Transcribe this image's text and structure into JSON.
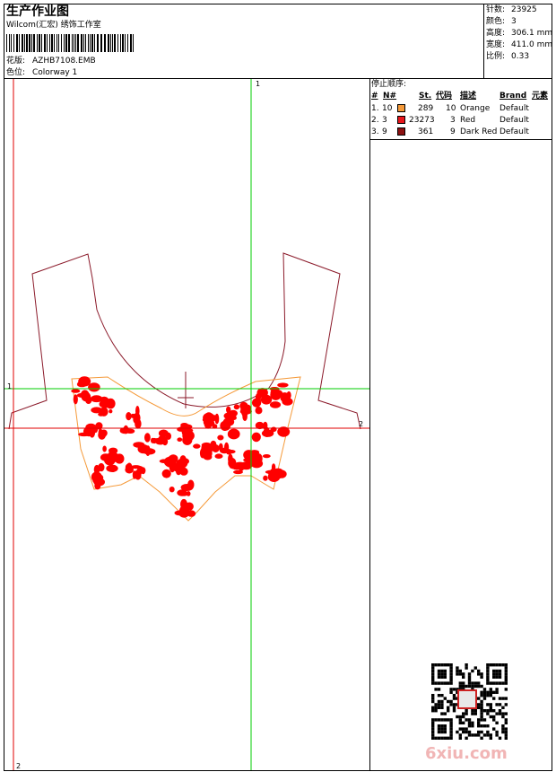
{
  "header": {
    "title": "生产作业图",
    "subtitle": "Wilcom(汇宏) 绣饰工作室",
    "design_label": "花版:",
    "design_value": "AZHB7108.EMB",
    "colorway_label": "色位:",
    "colorway_value": "Colorway 1"
  },
  "stats": [
    {
      "label": "针数:",
      "value": "23925"
    },
    {
      "label": "颜色:",
      "value": "3"
    },
    {
      "label": "高度:",
      "value": "306.1 mm"
    },
    {
      "label": "宽度:",
      "value": "411.0 mm"
    },
    {
      "label": "比例:",
      "value": "0.33"
    }
  ],
  "stops": {
    "title": "停止顺序:",
    "columns": [
      "#",
      "N#",
      "St.",
      "代码",
      "描述",
      "Brand",
      "元素"
    ],
    "rows": [
      {
        "index": "1.",
        "needle": "10",
        "color": "#f59a3a",
        "stitches": "289",
        "code": "10",
        "desc": "Orange",
        "brand": "Default"
      },
      {
        "index": "2.",
        "needle": "3",
        "color": "#e8161c",
        "stitches": "23273",
        "code": "3",
        "desc": "Red",
        "brand": "Default"
      },
      {
        "index": "3.",
        "needle": "9",
        "color": "#8c1111",
        "stitches": "361",
        "code": "9",
        "desc": "Dark Red",
        "brand": "Default"
      }
    ]
  },
  "canvas": {
    "marker_top": "1",
    "marker_left": "1",
    "marker_right": "2",
    "marker_bottom": "2",
    "guide_green": "#00cc00",
    "guide_red": "#e00000",
    "outline_color": "#8b1a2a",
    "embroidery_color": "#ff0000",
    "border_color": "#f59a3a"
  },
  "watermark": {
    "text": "6xiu.com"
  }
}
